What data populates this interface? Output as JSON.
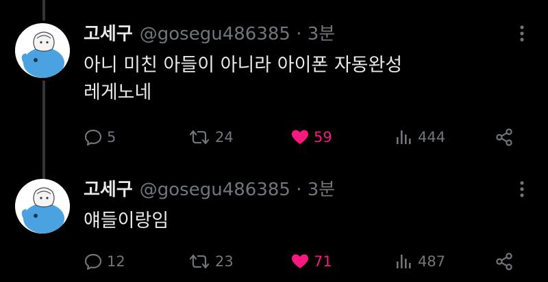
{
  "tweets": [
    {
      "name": "고세구",
      "handle": "@gosegu486385 · 3분",
      "text_lines": [
        "아니 미친 아들이 아니라 아이폰 자동완성",
        "레게노네"
      ],
      "replies": "5",
      "retweets": "24",
      "likes": "59",
      "views": "444"
    },
    {
      "name": "고세구",
      "handle": "@gosegu486385 · 3분",
      "text_lines": [
        "얘들이랑임"
      ],
      "replies": "12",
      "retweets": "23",
      "likes": "71",
      "views": "487"
    }
  ],
  "colors": {
    "background": "#000000",
    "text": "#e7e9ea",
    "muted": "#71767b",
    "like": "#f91880",
    "thread_line": "#333639"
  },
  "icons": [
    "reply-icon",
    "retweet-icon",
    "heart-icon",
    "views-icon",
    "share-icon",
    "more-icon"
  ]
}
